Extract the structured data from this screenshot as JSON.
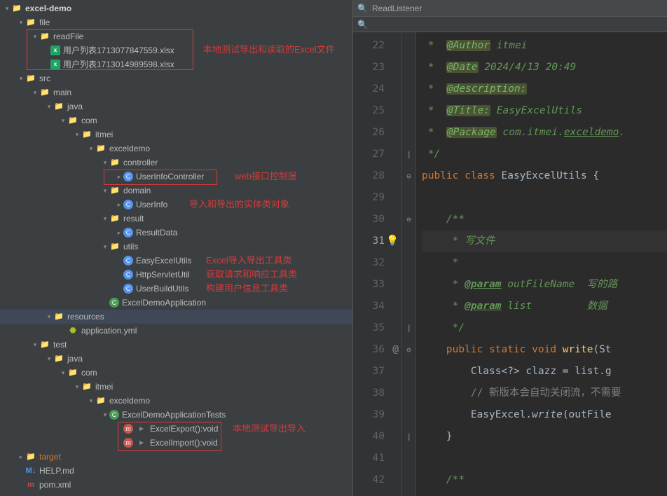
{
  "search": {
    "value": "ReadListener",
    "icon": "🔍"
  },
  "tree": {
    "root": "excel-demo",
    "n_file": "file",
    "n_readFile": "readFile",
    "xlsx1": "用户列表1713077847559.xlsx",
    "xlsx2": "用户列表1713014989598.xlsx",
    "src": "src",
    "main": "main",
    "java": "java",
    "com": "com",
    "itmei": "itmei",
    "exceldemo": "exceldemo",
    "controller": "controller",
    "userInfoController": "UserInfoController",
    "domain": "domain",
    "userInfo": "UserInfo",
    "result": "result",
    "resultData": "ResultData",
    "utils": "utils",
    "easyExcelUtils": "EasyExcelUtils",
    "httpServletUtil": "HttpServletUtil",
    "userBuildUtils": "UserBuildUtils",
    "excelDemoApplication": "ExcelDemoApplication",
    "resources": "resources",
    "applicationYml": "application.yml",
    "test": "test",
    "java2": "java",
    "com2": "com",
    "itmei2": "itmei",
    "exceldemo2": "exceldemo",
    "excelDemoAppTests": "ExcelDemoApplicationTests",
    "excelExport": "ExcelExport():void",
    "excelImport": "ExcelImport():void",
    "target": "target",
    "helpMd": "HELP.md",
    "pomXml": "pom.xml"
  },
  "annotations": {
    "a1": "本地测试导出和读取的Excel文件",
    "a2": "web接口控制层",
    "a3": "导入和导出的实体类对象",
    "a4": "Excel导入导出工具类",
    "a5": "获取请求和响应工具类",
    "a6": "构建用户信息工具类",
    "a7": "本地测试导出导入"
  },
  "code": {
    "lines": [
      {
        "n": 22,
        "html": " *  <span class='c-tagbg'>@Author</span> <span class='c-val'>itmei</span>"
      },
      {
        "n": 23,
        "html": " *  <span class='c-tagbg'>@Date</span> <span class='c-val'>2024/4/13 20:49</span>"
      },
      {
        "n": 24,
        "html": " *  <span class='c-tagbg'>@description:</span>"
      },
      {
        "n": 25,
        "html": " *  <span class='c-tagbg'>@Title:</span> <span class='c-val'>EasyExcelUtils</span>"
      },
      {
        "n": 26,
        "html": " *  <span class='c-tagbg'>@Package</span> <span class='c-val'>com.itmei.<u>exceldemo</u>.</span>"
      },
      {
        "n": 27,
        "html": " */"
      },
      {
        "n": 28,
        "html": "<span class='c-kw'>public class </span><span class='c-cls'>EasyExcelUtils {</span>",
        "ni": true
      },
      {
        "n": 29,
        "html": ""
      },
      {
        "n": 30,
        "html": "    <span class='c-green'>/**</span>"
      },
      {
        "n": 31,
        "html": "    <span class='c-green'> * 写文件</span>",
        "bulb": true,
        "cur": true
      },
      {
        "n": 32,
        "html": "    <span class='c-green'> *</span>"
      },
      {
        "n": 33,
        "html": "    <span class='c-green'> * <span class='c-tag'>@param</span> <span class='c-val'>outFileName  写的路</span></span>"
      },
      {
        "n": 34,
        "html": "    <span class='c-green'> * <span class='c-tag'>@param</span> <span class='c-val'>list         数据</span></span>"
      },
      {
        "n": 35,
        "html": "    <span class='c-green'> */</span>"
      },
      {
        "n": 36,
        "html": "    <span class='c-kw'>public static void </span><span class='c-m'>write</span><span class='c-cls'>(St</span>",
        "ni": true,
        "at": true
      },
      {
        "n": 37,
        "html": "        <span class='c-cls'>Class&lt;?&gt; clazz = list.g</span>",
        "ni": true
      },
      {
        "n": 38,
        "html": "        <span class='c-str'>// 新版本会自动关闭流，不需要</span>",
        "ni": true
      },
      {
        "n": 39,
        "html": "        <span class='c-cls'>EasyExcel.</span><span class='c-call'>write</span><span class='c-cls'>(outFile</span>",
        "ni": true
      },
      {
        "n": 40,
        "html": "    <span class='c-cls'>}</span>",
        "ni": true
      },
      {
        "n": 41,
        "html": ""
      },
      {
        "n": 42,
        "html": "    <span class='c-green'>/**</span>"
      }
    ]
  }
}
